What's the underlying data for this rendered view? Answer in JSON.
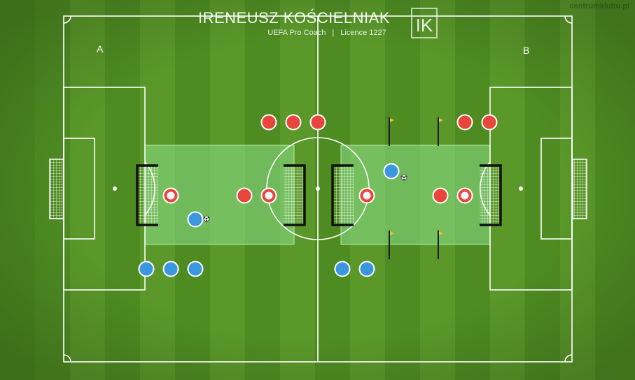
{
  "header": {
    "coach_name": "IRENEUSZ KOŚCIELNIAK",
    "coach_role": "UEFA Pro Coach",
    "separator": "|",
    "licence": "Licence 1227",
    "logo_letters": "IK"
  },
  "watermark": "centrumklubu.pl",
  "pitch_labels": {
    "left_end": "A",
    "right_end": "B"
  },
  "colors": {
    "grass_dark": "#4e8c22",
    "grass_light": "#5c9a2a",
    "lines": "#ffffff",
    "zone_fill": "#7fd17a",
    "team_red": "#e8453c",
    "team_blue": "#3a97dd",
    "flag": "#f0c419",
    "goal_frame": "#111111"
  }
}
